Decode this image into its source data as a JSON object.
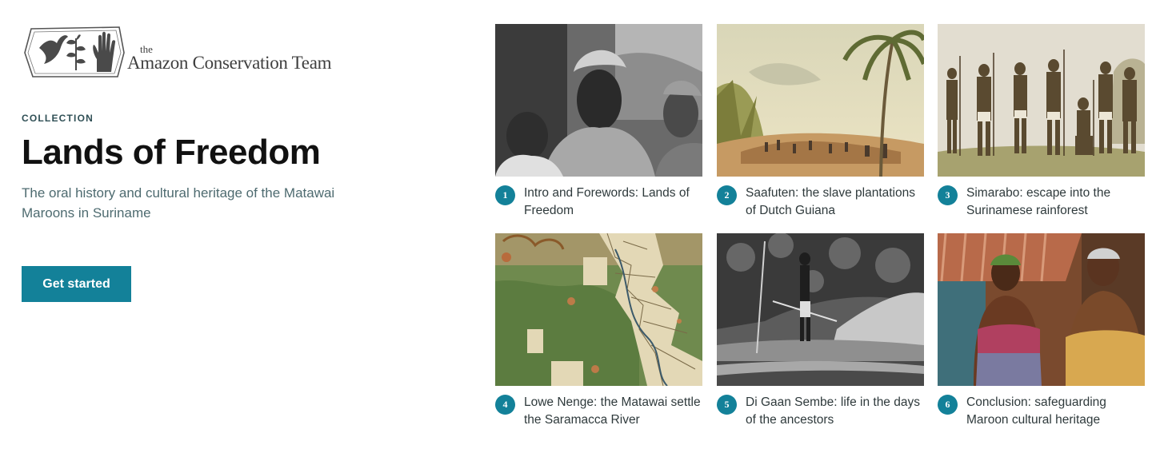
{
  "brand": {
    "logo_the": "the",
    "logo_name": "Amazon Conservation Team"
  },
  "hero": {
    "eyebrow": "COLLECTION",
    "title": "Lands of Freedom",
    "subtitle": "The oral history and cultural heritage of the Matawai Maroons in Suriname",
    "cta_label": "Get started"
  },
  "chapters": [
    {
      "number": "1",
      "title": "Intro and Forewords: Lands of Freedom",
      "image": "portrait-photo"
    },
    {
      "number": "2",
      "title": "Saafuten: the slave plantations of Dutch Guiana",
      "image": "plantation-painting"
    },
    {
      "number": "3",
      "title": "Simarabo: escape into the Surinamese rainforest",
      "image": "maroon-warriors-illustration"
    },
    {
      "number": "4",
      "title": "Lowe Nenge: the Matawai settle the Saramacca River",
      "image": "historic-map"
    },
    {
      "number": "5",
      "title": "Di Gaan Sembe: life in the days of the ancestors",
      "image": "canoe-photo"
    },
    {
      "number": "6",
      "title": "Conclusion: safeguarding Maroon cultural heritage",
      "image": "elders-photo"
    }
  ],
  "colors": {
    "accent": "#138199",
    "eyebrow": "#2f4f55",
    "subtitle": "#4e6b70"
  }
}
